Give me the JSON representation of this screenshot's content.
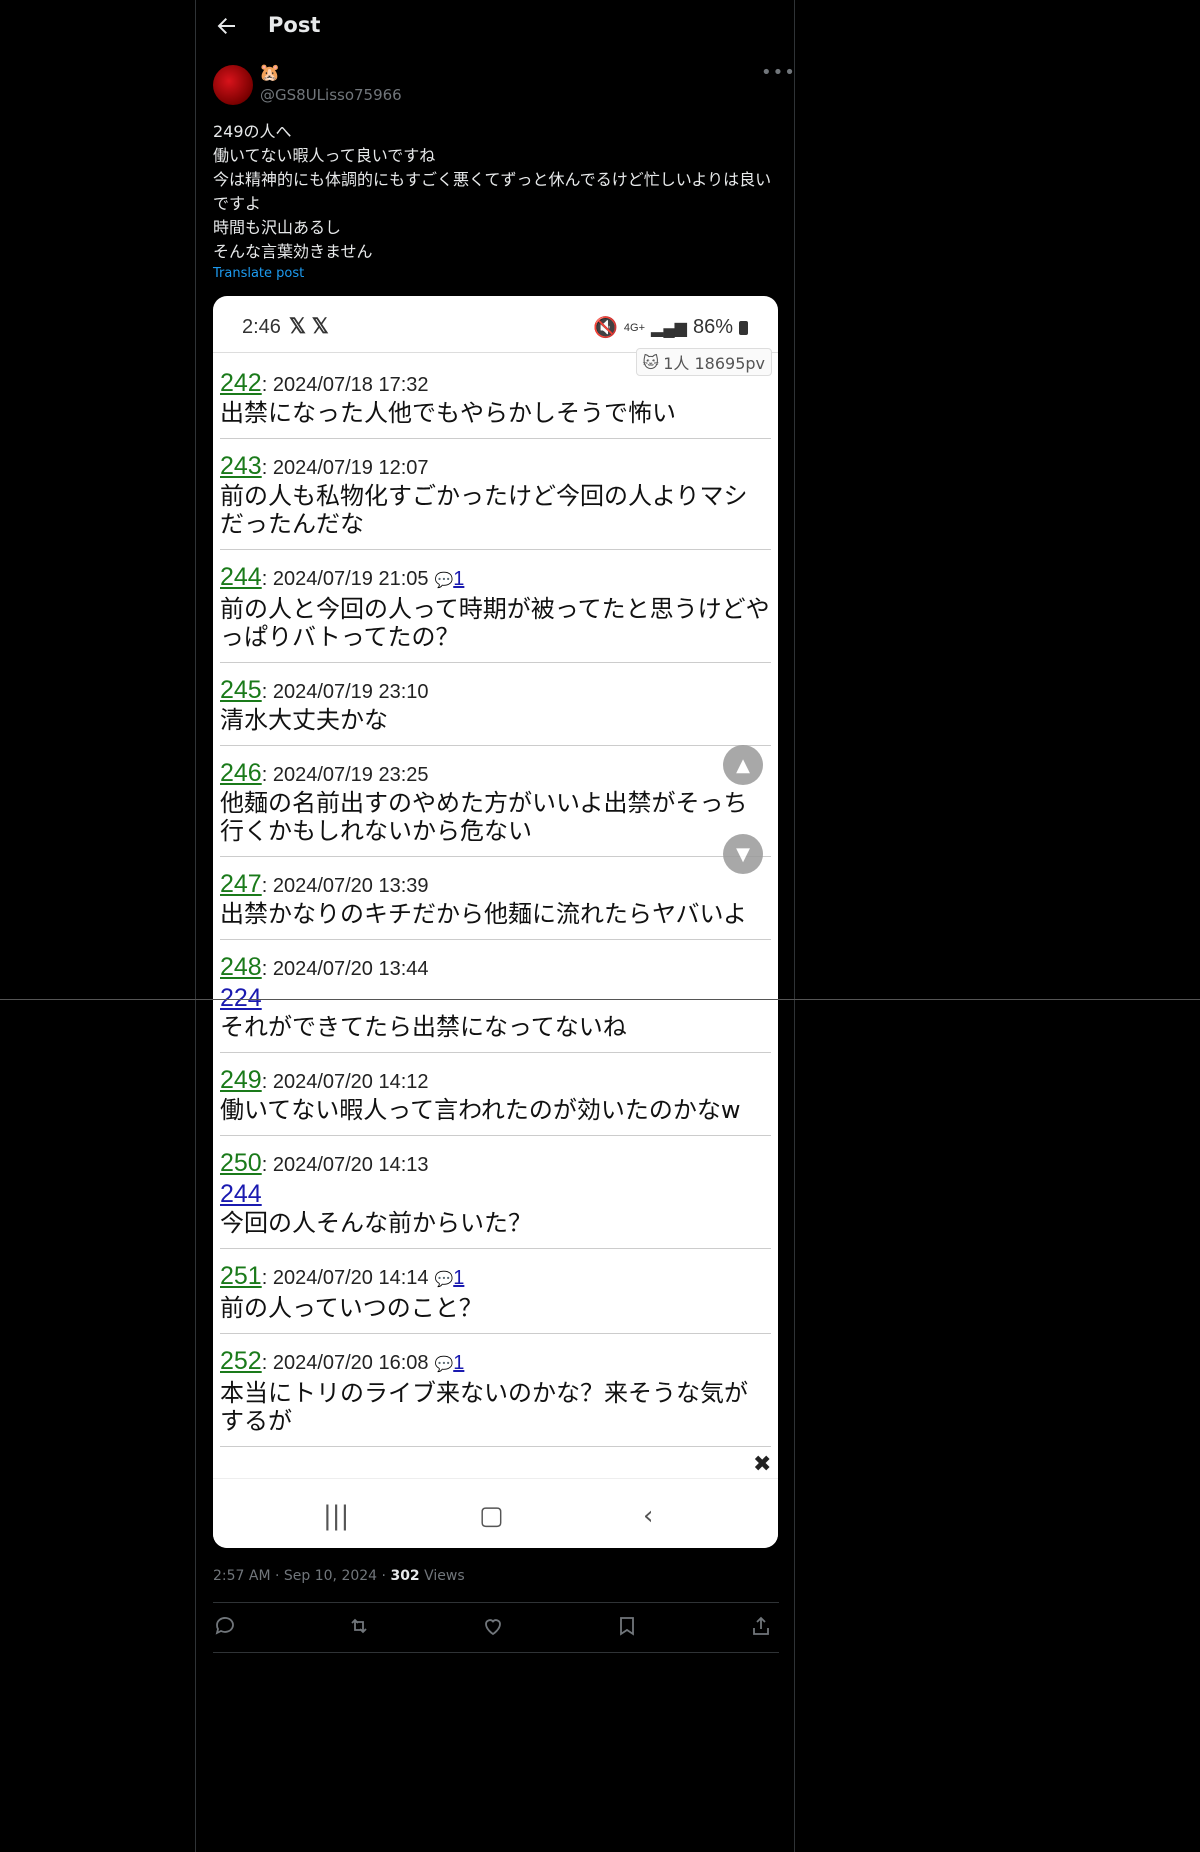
{
  "header": {
    "title": "Post"
  },
  "author": {
    "emoji": "🐹",
    "handle": "@GS8ULisso75966"
  },
  "post": {
    "lines": [
      "249の人へ",
      "働いてない暇人って良いですね",
      "今は精神的にも体調的にもすごく悪くてずっと休んでるけど忙しいよりは良いですよ",
      "時間も沢山あるし",
      "そんな言葉効きません"
    ],
    "translate_label": "Translate post"
  },
  "screenshot": {
    "status_time": "2:46",
    "status_x": "𝕏 𝕏",
    "status_net": "4G+",
    "battery": "86%",
    "pv": "1人 18695pv",
    "posts": [
      {
        "num": "242",
        "date": ": 2024/07/18 17:32",
        "reply": "",
        "anchor": "",
        "text": "出禁になった人他でもやらかしそうで怖い"
      },
      {
        "num": "243",
        "date": ": 2024/07/19 12:07",
        "reply": "",
        "anchor": "",
        "text": "前の人も私物化すごかったけど今回の人よりマシだったんだな"
      },
      {
        "num": "244",
        "date": ": 2024/07/19 21:05",
        "reply": "1",
        "anchor": "",
        "text": "前の人と今回の人って時期が被ってたと思うけどやっぱりバトってたの？"
      },
      {
        "num": "245",
        "date": ": 2024/07/19 23:10",
        "reply": "",
        "anchor": "",
        "text": "清水大丈夫かな"
      },
      {
        "num": "246",
        "date": ": 2024/07/19 23:25",
        "reply": "",
        "anchor": "",
        "text": "他麺の名前出すのやめた方がいいよ出禁がそっち行くかもしれないから危ない"
      },
      {
        "num": "247",
        "date": ": 2024/07/20 13:39",
        "reply": "",
        "anchor": "",
        "text": "出禁かなりのキチだから他麺に流れたらヤバいよ"
      },
      {
        "num": "248",
        "date": ": 2024/07/20 13:44",
        "reply": "",
        "anchor": "224",
        "text": "それができてたら出禁になってないね"
      },
      {
        "num": "249",
        "date": ": 2024/07/20 14:12",
        "reply": "",
        "anchor": "",
        "text": "働いてない暇人って言われたのが効いたのかなw"
      },
      {
        "num": "250",
        "date": ": 2024/07/20 14:13",
        "reply": "",
        "anchor": "244",
        "text": "今回の人そんな前からいた？"
      },
      {
        "num": "251",
        "date": ": 2024/07/20 14:14",
        "reply": "1",
        "anchor": "",
        "text": "前の人っていつのこと？"
      },
      {
        "num": "252",
        "date": ": 2024/07/20 16:08",
        "reply": "1",
        "anchor": "",
        "text": "本当にトリのライブ来ないのかな？来そうな気がするが"
      }
    ]
  },
  "meta": {
    "time": "2:57 AM",
    "sep": "·",
    "date": "Sep 10, 2024",
    "views": "302",
    "views_label": "Views"
  }
}
